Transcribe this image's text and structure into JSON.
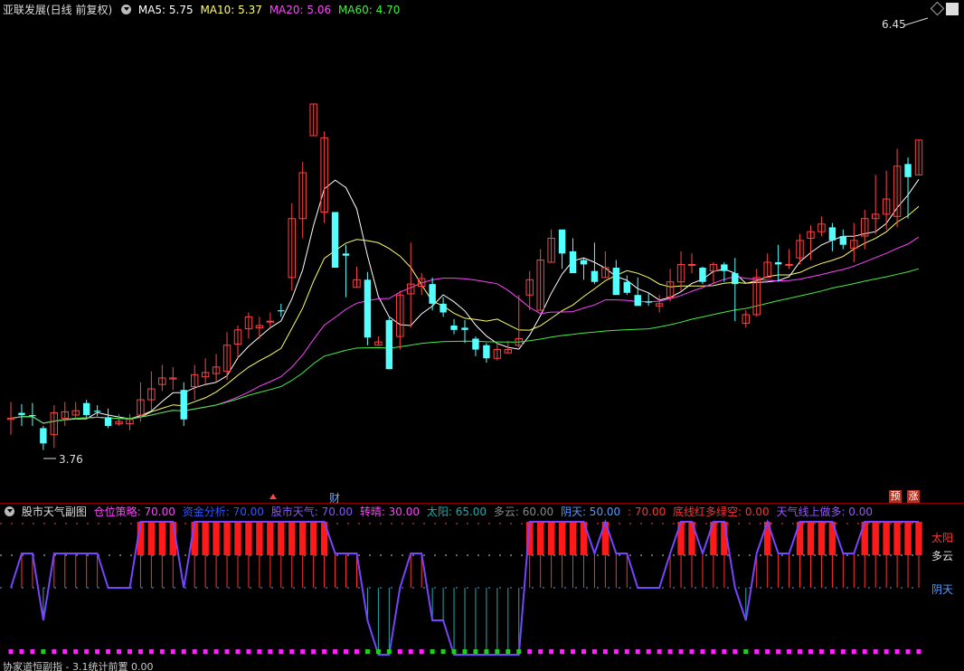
{
  "main": {
    "title": "亚联发展(日线 前复权)",
    "ma": [
      {
        "label": "MA5: 5.75",
        "color": "#ffffff"
      },
      {
        "label": "MA10: 5.37",
        "color": "#ffff66"
      },
      {
        "label": "MA20: 5.06",
        "color": "#ff44ff"
      },
      {
        "label": "MA60: 4.70",
        "color": "#44ee44"
      }
    ],
    "high_label": "6.45",
    "low_label": "3.76",
    "cai_label": "财",
    "yu_label": "预",
    "zhang_label": "涨"
  },
  "sub": {
    "title": "股市天气副图",
    "items": [
      {
        "label": "仓位策略: 70.00",
        "color": "#ff44ff"
      },
      {
        "label": "资金分析: 70.00",
        "color": "#3355ff"
      },
      {
        "label": "股市天气: 70.00",
        "color": "#8855ff"
      },
      {
        "label": "转晴: 30.00",
        "color": "#ff44ff"
      },
      {
        "label": "太阳: 65.00",
        "color": "#22aaaa"
      },
      {
        "label": "多云: 60.00",
        "color": "#888888"
      },
      {
        "label": "阴天: 50.00",
        "color": "#5599ff"
      },
      {
        "label": ": 70.00",
        "color": "#ff3333"
      },
      {
        "label": "底线红多绿空: 0.00",
        "color": "#ff3333"
      },
      {
        "label": "天气线上做多: 0.00",
        "color": "#9955ff"
      }
    ],
    "levels": [
      {
        "label": "太阳",
        "color": "#ff3333"
      },
      {
        "label": "多云",
        "color": "#dddddd"
      },
      {
        "label": "阴天",
        "color": "#5599ff"
      }
    ],
    "bottom_label": "协家道恒副指 - 3.1统计前置 0.00"
  },
  "chart_data": {
    "type": "candlestick",
    "candles": [
      [
        4.06,
        4.07,
        4.22,
        3.92
      ],
      [
        4.12,
        4.1,
        4.2,
        4.0
      ],
      [
        4.1,
        4.09,
        4.21,
        4.0
      ],
      [
        3.98,
        3.84,
        4.0,
        3.78
      ],
      [
        3.92,
        4.12,
        4.19,
        3.8
      ],
      [
        4.07,
        4.13,
        4.22,
        4.0
      ],
      [
        4.1,
        4.14,
        4.22,
        4.06
      ],
      [
        4.21,
        4.1,
        4.24,
        4.08
      ],
      [
        4.14,
        4.13,
        4.19,
        4.09
      ],
      [
        4.08,
        4.0,
        4.16,
        3.98
      ],
      [
        4.02,
        4.04,
        4.11,
        4.0
      ],
      [
        4.02,
        4.06,
        4.11,
        3.96
      ],
      [
        4.1,
        4.24,
        4.4,
        4.04
      ],
      [
        4.24,
        4.34,
        4.5,
        4.14
      ],
      [
        4.38,
        4.44,
        4.56,
        4.32
      ],
      [
        4.43,
        4.44,
        4.54,
        4.33
      ],
      [
        4.33,
        4.06,
        4.4,
        4.0
      ],
      [
        4.36,
        4.47,
        4.56,
        4.24
      ],
      [
        4.45,
        4.49,
        4.62,
        4.38
      ],
      [
        4.48,
        4.54,
        4.66,
        4.4
      ],
      [
        4.5,
        4.74,
        4.86,
        4.42
      ],
      [
        4.75,
        4.88,
        4.92,
        4.62
      ],
      [
        4.89,
        5.0,
        5.04,
        4.8
      ],
      [
        4.9,
        4.92,
        5.0,
        4.8
      ],
      [
        4.96,
        4.96,
        5.04,
        4.91
      ],
      [
        5.06,
        5.05,
        5.12,
        5.0
      ],
      [
        5.36,
        5.9,
        6.04,
        5.24
      ],
      [
        5.9,
        6.32,
        6.42,
        5.72
      ],
      [
        6.66,
        6.95,
        6.84,
        6.94
      ],
      [
        5.96,
        6.64,
        6.7,
        5.86
      ],
      [
        5.96,
        5.45,
        5.85,
        5.88
      ],
      [
        5.58,
        5.56,
        5.66,
        5.18
      ],
      [
        5.27,
        5.34,
        5.46,
        5.29
      ],
      [
        5.34,
        4.81,
        5.41,
        4.74
      ],
      [
        4.74,
        4.77,
        4.82,
        4.82
      ],
      [
        4.97,
        4.52,
        4.99,
        4.61
      ],
      [
        4.82,
        5.2,
        5.24,
        4.7
      ],
      [
        5.21,
        5.3,
        5.68,
        4.9
      ],
      [
        5.28,
        5.35,
        5.4,
        5.2
      ],
      [
        5.3,
        5.12,
        5.36,
        5.06
      ],
      [
        5.12,
        5.04,
        5.18,
        5.0
      ],
      [
        4.92,
        4.88,
        4.98,
        4.84
      ],
      [
        4.9,
        4.88,
        4.97,
        4.76
      ],
      [
        4.8,
        4.7,
        4.82,
        4.64
      ],
      [
        4.74,
        4.62,
        4.76,
        4.58
      ],
      [
        4.62,
        4.7,
        4.76,
        4.6
      ],
      [
        4.67,
        4.7,
        4.78,
        4.68
      ],
      [
        4.74,
        4.8,
        5.2,
        4.72
      ],
      [
        5.2,
        5.34,
        5.42,
        5.06
      ],
      [
        5.06,
        5.52,
        5.62,
        5.16
      ],
      [
        5.5,
        5.72,
        5.8,
        5.5
      ],
      [
        5.8,
        5.58,
        5.64,
        5.44
      ],
      [
        5.6,
        5.4,
        5.72,
        5.4
      ],
      [
        5.52,
        5.48,
        5.54,
        5.34
      ],
      [
        5.42,
        5.32,
        5.68,
        5.3
      ],
      [
        5.36,
        5.45,
        5.6,
        5.42
      ],
      [
        5.45,
        5.2,
        5.52,
        5.44
      ],
      [
        5.32,
        5.22,
        5.38,
        5.2
      ],
      [
        5.2,
        5.1,
        5.36,
        5.18
      ],
      [
        5.14,
        5.13,
        5.22,
        5.1
      ],
      [
        5.1,
        5.12,
        5.2,
        5.04
      ],
      [
        5.18,
        5.32,
        5.44,
        5.14
      ],
      [
        5.32,
        5.48,
        5.6,
        5.24
      ],
      [
        5.48,
        5.48,
        5.58,
        5.4
      ],
      [
        5.45,
        5.32,
        5.46,
        5.3
      ],
      [
        5.42,
        5.48,
        5.5,
        5.3
      ],
      [
        5.48,
        5.42,
        5.5,
        5.32
      ],
      [
        5.4,
        5.3,
        5.54,
        4.96
      ],
      [
        4.94,
        5.02,
        5.06,
        4.9
      ],
      [
        5.02,
        5.36,
        5.44,
        5.0
      ],
      [
        5.36,
        5.5,
        5.58,
        5.36
      ],
      [
        5.5,
        5.48,
        5.66,
        5.32
      ],
      [
        5.48,
        5.48,
        5.62,
        5.44
      ],
      [
        5.54,
        5.7,
        5.76,
        5.48
      ],
      [
        5.72,
        5.78,
        5.84,
        5.52
      ],
      [
        5.78,
        5.85,
        5.92,
        5.74
      ],
      [
        5.82,
        5.7,
        5.86,
        5.6
      ],
      [
        5.74,
        5.66,
        5.8,
        5.62
      ],
      [
        5.63,
        5.7,
        5.86,
        5.5
      ],
      [
        5.74,
        5.9,
        5.98,
        5.62
      ],
      [
        5.9,
        5.94,
        6.3,
        5.76
      ],
      [
        5.94,
        6.08,
        6.34,
        5.8
      ],
      [
        5.92,
        6.38,
        6.54,
        5.82
      ],
      [
        6.4,
        6.28,
        6.46,
        5.9
      ],
      [
        6.3,
        6.62,
        6.48,
        6.3
      ]
    ]
  }
}
